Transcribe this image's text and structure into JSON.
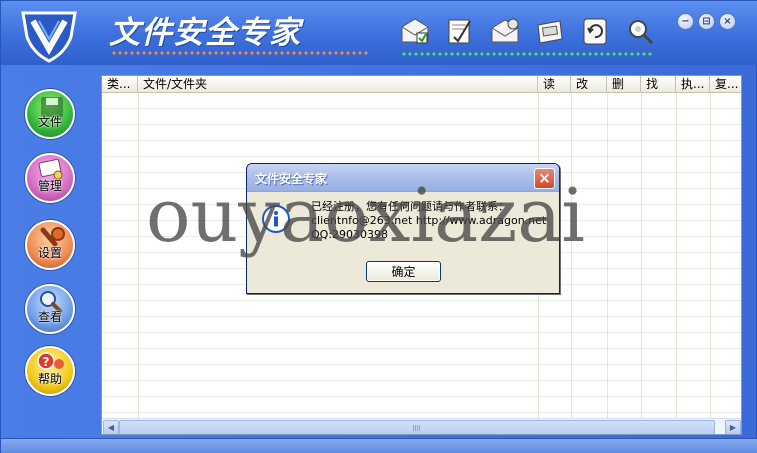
{
  "app": {
    "title": "文件安全专家",
    "accent_color": "#3d70dc"
  },
  "toolbar": {
    "icons": [
      "encrypt-envelope-icon",
      "document-pen-icon",
      "decrypt-envelope-icon",
      "disk-tag-icon",
      "refresh-document-icon",
      "search-gear-icon"
    ]
  },
  "window_controls": {
    "minimize": "−",
    "restore": "⊟",
    "close": "×"
  },
  "sidebar": {
    "items": [
      {
        "label": "文件",
        "icon": "floppy-disk-icon"
      },
      {
        "label": "管理",
        "icon": "key-card-icon"
      },
      {
        "label": "设置",
        "icon": "wrench-icon"
      },
      {
        "label": "查看",
        "icon": "magnifier-icon"
      },
      {
        "label": "帮助",
        "icon": "help-question-icon"
      }
    ]
  },
  "list": {
    "columns": [
      "类...",
      "文件/文件夹",
      "读",
      "改",
      "删",
      "找",
      "执...",
      "复..."
    ]
  },
  "dialog": {
    "title": "文件安全专家",
    "close": "×",
    "message_lines": [
      "已经注册，您有任何问题请与作者联系：",
      "clientnfo@263.net http://www.adragon.net",
      "QQ:29030398"
    ],
    "ok_label": "确定"
  },
  "watermark": "ouyaoxiazai"
}
